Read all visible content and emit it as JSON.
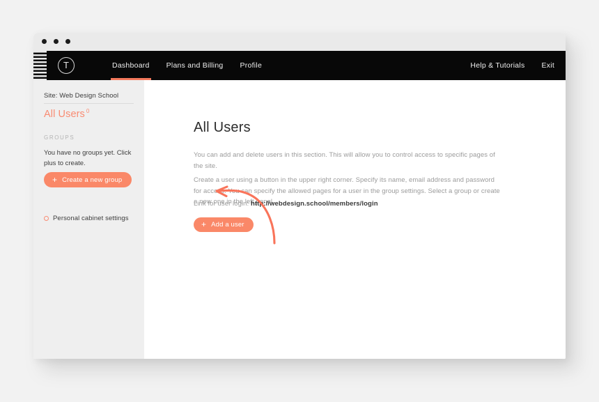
{
  "window": {
    "titlebar": {
      "dots": [
        "close-dot",
        "minimize-dot",
        "maximize-dot"
      ]
    }
  },
  "navbar": {
    "logo_glyph": "T",
    "left_items": [
      {
        "label": "Dashboard",
        "active": true
      },
      {
        "label": "Plans and Billing",
        "active": false
      },
      {
        "label": "Profile",
        "active": false
      }
    ],
    "right_items": [
      {
        "label": "Help & Tutorials"
      },
      {
        "label": "Exit"
      }
    ],
    "active_underline_color": "#f4795c",
    "background_color": "#080808"
  },
  "sidebar": {
    "site_label": "Site: Web Design School",
    "all_users": {
      "label": "All Users",
      "count": "0"
    },
    "groups_heading": "GROUPS",
    "groups_empty_text": "You have no groups yet. Click plus to create.",
    "create_group_button": {
      "plus": "+",
      "label": "Create a new group"
    },
    "personal_cabinet": {
      "icon": "circle-icon",
      "label": "Personal cabinet settings"
    },
    "background_color": "#efefef",
    "accent_color": "#f98b72"
  },
  "main": {
    "title": "All Users",
    "paragraph_1": "You can add and delete users in this section. This will allow you to control access to specific pages of the site.",
    "paragraph_2": "Create a user using a button in the upper right corner. Specify its name, email address and password for access. You can specify the allowed pages for a user in the group settings. Select a group or create a new one in the left panel.",
    "link_label": "Link for user login:",
    "link_url": "http://webdesign.school/members/login",
    "add_user_button": {
      "plus": "+",
      "label": "Add a user"
    },
    "button_color": "#fa8868"
  },
  "annotation": {
    "arrow_color": "#f9745a",
    "description": "curved arrow pointing to Add a user button"
  }
}
